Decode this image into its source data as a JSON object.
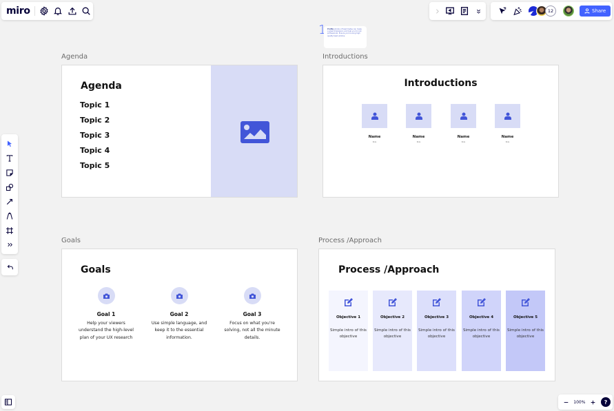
{
  "app": {
    "logo": "miro",
    "share_label": "Share",
    "collaborator_count": "12",
    "zoom_level": "100%",
    "help_label": "?"
  },
  "colors": {
    "accent": "#4262ff",
    "icon_blue": "#4255d8",
    "tile_light": "#d8dcf6",
    "objective_fills": [
      "#f4f5fe",
      "#e7e9fc",
      "#dcdffb",
      "#d0d4fa",
      "#c3c8f8"
    ]
  },
  "top_toolbar": {
    "left_icons": [
      "gear-icon",
      "bell-icon",
      "upload-icon",
      "search-icon"
    ],
    "right_icons": [
      "chevron-right-icon",
      "presentation-icon",
      "notes-icon",
      "double-chevron-down-icon",
      "cursor-icon",
      "celebrate-icon"
    ]
  },
  "left_toolbar": {
    "tools": [
      "select-icon",
      "text-icon",
      "sticky-note-icon",
      "shapes-icon",
      "arrow-icon",
      "pen-icon",
      "frame-icon",
      "more-tools-icon"
    ],
    "undo": "undo-icon"
  },
  "sticky_note": {
    "number": "1",
    "text_bold": "Profile",
    "text": " photos of teammates can make a great impression and help you to look professional. Ensure you're using high quality team photos."
  },
  "frames": {
    "agenda": {
      "label": "Agenda",
      "title": "Agenda",
      "topics": [
        "Topic 1",
        "Topic 2",
        "Topic 3",
        "Topic 4",
        "Topic 5"
      ]
    },
    "introductions": {
      "label": "Introductions",
      "title": "Introductions",
      "people": [
        {
          "name": "Name",
          "role": "Role"
        },
        {
          "name": "Name",
          "role": "Role"
        },
        {
          "name": "Name",
          "role": "Role"
        },
        {
          "name": "Name",
          "role": "Role"
        }
      ]
    },
    "goals": {
      "label": "Goals",
      "title": "Goals",
      "items": [
        {
          "title": "Goal 1",
          "desc": "Help your viewers understand the high-level plan of your UX research"
        },
        {
          "title": "Goal 2",
          "desc": "Use simple language, and keep it to the essential information."
        },
        {
          "title": "Goal 3",
          "desc": "Focus on what you're solving, not all the minute details."
        }
      ]
    },
    "process": {
      "label": "Process /Approach",
      "title": "Process /Approach",
      "objectives": [
        {
          "title": "Objective 1",
          "desc": "Simple intro of this objective"
        },
        {
          "title": "Objective 2",
          "desc": "Simple intro of this objective"
        },
        {
          "title": "Objective 3",
          "desc": "Simple intro of this objective"
        },
        {
          "title": "Objective 4",
          "desc": "Simple intro of this objective"
        },
        {
          "title": "Objective 5",
          "desc": "Simple intro of this objective"
        }
      ]
    }
  }
}
